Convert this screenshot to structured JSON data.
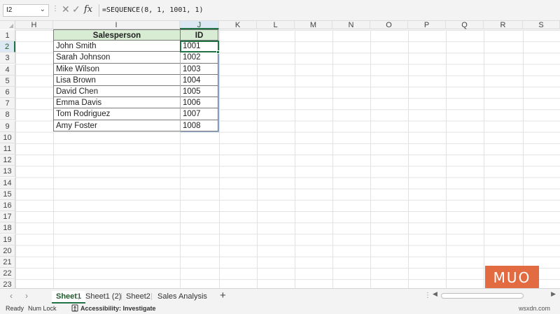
{
  "formula_bar": {
    "name_box": "I2",
    "cancel_icon": "✕",
    "enter_icon": "✓",
    "fx_label": "fx",
    "formula": "=SEQUENCE(8, 1, 1001, 1)"
  },
  "columns": [
    "H",
    "I",
    "J",
    "K",
    "L",
    "M",
    "N",
    "O",
    "P",
    "Q",
    "R",
    "S"
  ],
  "rows": [
    "1",
    "2",
    "3",
    "4",
    "5",
    "6",
    "7",
    "8",
    "9",
    "10",
    "11",
    "12",
    "13",
    "14",
    "15",
    "16",
    "17",
    "18",
    "19",
    "20",
    "21",
    "22",
    "23"
  ],
  "table": {
    "header_name": "Salesperson",
    "header_id": "ID",
    "rows": [
      {
        "name": "John Smith",
        "id": "1001"
      },
      {
        "name": "Sarah Johnson",
        "id": "1002"
      },
      {
        "name": "Mike Wilson",
        "id": "1003"
      },
      {
        "name": "Lisa Brown",
        "id": "1004"
      },
      {
        "name": "David Chen",
        "id": "1005"
      },
      {
        "name": "Emma Davis",
        "id": "1006"
      },
      {
        "name": "Tom Rodriguez",
        "id": "1007"
      },
      {
        "name": "Amy Foster",
        "id": "1008"
      }
    ]
  },
  "sheet_tabs": {
    "tabs": [
      "Sheet1",
      "Sheet1 (2)",
      "Sheet2",
      "Sales Analysis"
    ],
    "active": "Sheet1",
    "add_label": "+"
  },
  "status_bar": {
    "ready": "Ready",
    "num_lock": "Num Lock",
    "accessibility": "Accessibility: Investigate"
  },
  "watermark": {
    "logo": "MUO",
    "site": "wsxdn.com"
  },
  "colors": {
    "accent": "#217346",
    "header_fill": "#d8ecd3",
    "logo": "#e36b42"
  }
}
